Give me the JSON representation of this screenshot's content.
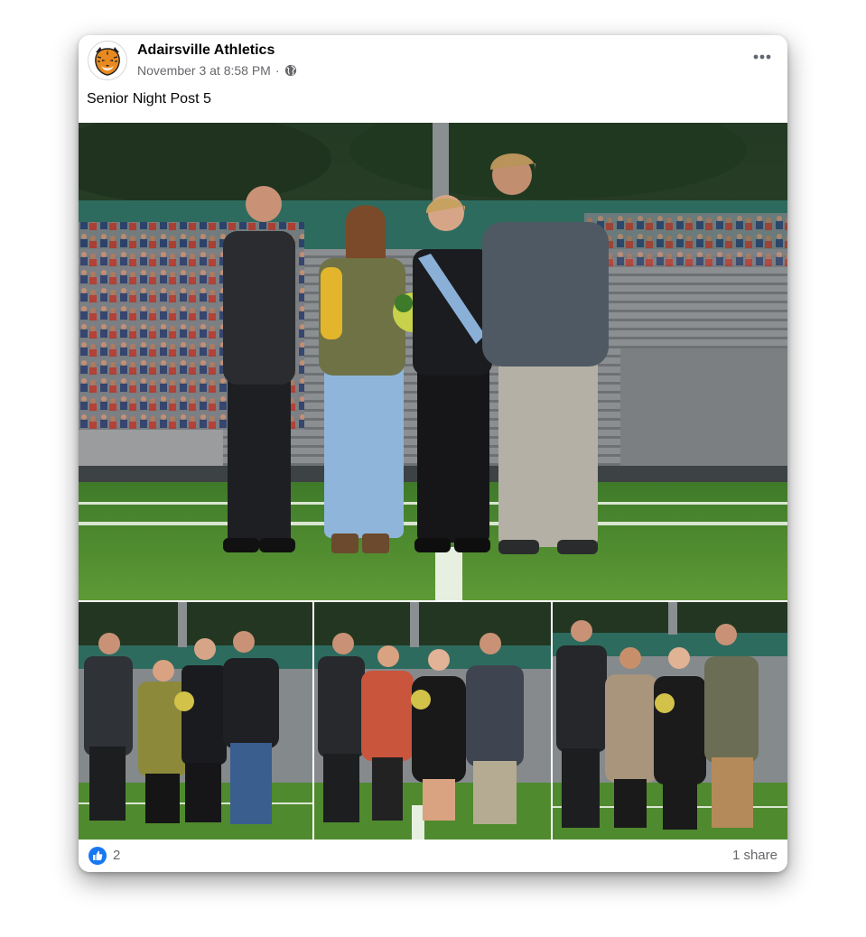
{
  "post": {
    "page_name": "Adairsville Athletics",
    "timestamp": "November 3 at 8:58 PM",
    "separator": "·",
    "privacy_icon": "globe-icon",
    "more_icon": "more-horizontal-icon",
    "text": "Senior Night Post 5"
  },
  "photos": [
    {
      "label": "Senior night group photo on football field, four people"
    },
    {
      "label": "Senior night photo 2"
    },
    {
      "label": "Senior night photo 3"
    },
    {
      "label": "Senior night photo 4"
    }
  ],
  "reactions": {
    "icon": "like-icon",
    "count": "2",
    "shares": "1 share"
  },
  "colors": {
    "accent": "#1877f2",
    "turf": "#4e8a2c",
    "secondary_text": "#65676b"
  }
}
